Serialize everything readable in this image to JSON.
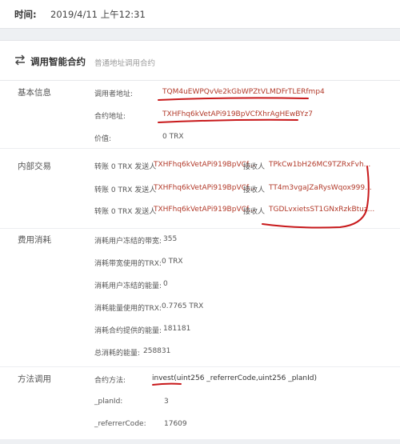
{
  "time_row": {
    "label": "时间:",
    "value": "2019/4/11 上午12:31"
  },
  "card": {
    "title": "调用智能合约",
    "subtitle": "普通地址调用合约",
    "icon": "swap-arrows-icon"
  },
  "basic": {
    "label": "基本信息",
    "caller_key": "调用者地址:",
    "caller_val": "TQM4uEWPQvVe2kGbWPZtVLMDFrTLERfmp4",
    "contract_key": "合约地址:",
    "contract_val": "TXHFhq6kVetAPi919BpVCfXhrAgHEwBYz7",
    "value_key": "价值:",
    "value_val": "0 TRX"
  },
  "internal": {
    "label": "内部交易",
    "rows": [
      {
        "transfer": "转账 0 TRX 发送人",
        "sender": "TXHFhq6kVetAPi919BpVCf...",
        "recv_label": "接收人",
        "receiver": "TPkCw1bH26MC9TZRxFvh..."
      },
      {
        "transfer": "转账 0 TRX 发送人",
        "sender": "TXHFhq6kVetAPi919BpVCf...",
        "recv_label": "接收人",
        "receiver": "TT4m3vgaJZaRysWqox999..."
      },
      {
        "transfer": "转账 0 TRX 发送人",
        "sender": "TXHFhq6kVetAPi919BpVCf...",
        "recv_label": "接收人",
        "receiver": "TGDLvxietsST1GNxRzkBtuz..."
      }
    ]
  },
  "fees": {
    "label": "费用消耗",
    "rows": [
      {
        "k": "消耗用户冻结的带宽:",
        "v": "355"
      },
      {
        "k": "消耗带宽使用的TRX:",
        "v": "0 TRX"
      },
      {
        "k": "消耗用户冻结的能量:",
        "v": "0"
      },
      {
        "k": "消耗能量使用的TRX:",
        "v": "0.7765 TRX"
      },
      {
        "k": "消耗合约提供的能量:",
        "v": "181181"
      },
      {
        "k": "总消耗的能量:",
        "v": "258831"
      }
    ]
  },
  "method": {
    "label": "方法调用",
    "method_key": "合约方法:",
    "method_name": "invest",
    "method_sig": "(uint256 _referrerCode,uint256 _planId)",
    "plan_key": "_planId:",
    "plan_val": "3",
    "ref_key": "_referrerCode:",
    "ref_val": "17609"
  },
  "colors": {
    "link": "#b23a2a",
    "annotation": "#c8191b"
  }
}
